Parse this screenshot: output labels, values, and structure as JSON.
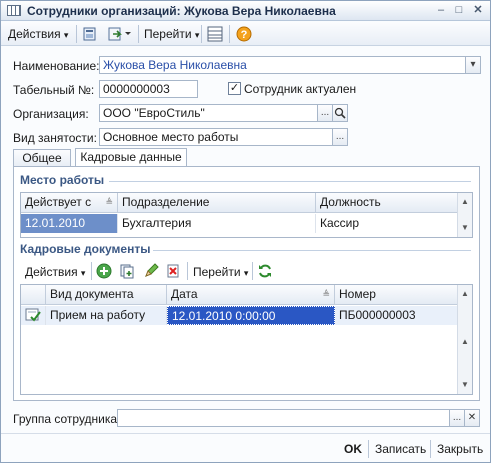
{
  "window": {
    "title": "Сотрудники организаций: Жукова Вера Николаевна",
    "minimize_glyph": "–",
    "maximize_glyph": "□",
    "close_glyph": "✕"
  },
  "toolbar": {
    "actions_label": "Действия",
    "goto_label": "Перейти",
    "help_glyph": "?",
    "dropdown_glyph": "▾"
  },
  "form": {
    "name_label": "Наименование:",
    "name_value": "Жукова Вера Николаевна",
    "tab_number_label": "Табельный №:",
    "tab_number_value": "0000000003",
    "active_checkbox_label": "Сотрудник актуален",
    "active_checked": "✓",
    "org_label": "Организация:",
    "org_value": "ООО \"ЕвроСтиль\"",
    "employment_label": "Вид занятости:",
    "employment_value": "Основное место работы",
    "ellipsis": "...",
    "search_glyph": "🔍",
    "group_label": "Группа сотрудника:",
    "group_value": "",
    "clear_glyph": "✕"
  },
  "tabs": [
    {
      "label": "Общее"
    },
    {
      "label": "Кадровые данные"
    }
  ],
  "workplace": {
    "title": "Место работы",
    "columns": [
      "Действует с",
      "Подразделение",
      "Должность"
    ],
    "rows": [
      {
        "date": "12.01.2010",
        "department": "Бухгалтерия",
        "position": "Кассир"
      }
    ]
  },
  "hr_docs": {
    "title": "Кадровые документы",
    "actions_label": "Действия",
    "goto_label": "Перейти",
    "columns": [
      "Вид документа",
      "Дата",
      "Номер"
    ],
    "rows": [
      {
        "type": "Прием на работу",
        "date": "12.01.2010 0:00:00",
        "number": "ПБ000000003"
      }
    ]
  },
  "footer": {
    "ok_label": "OK",
    "save_label": "Записать",
    "close_label": "Закрыть"
  },
  "colors": {
    "selection": "#c8d8f1",
    "selected_cell": "#2a57c4",
    "section_title": "#3b5884"
  }
}
